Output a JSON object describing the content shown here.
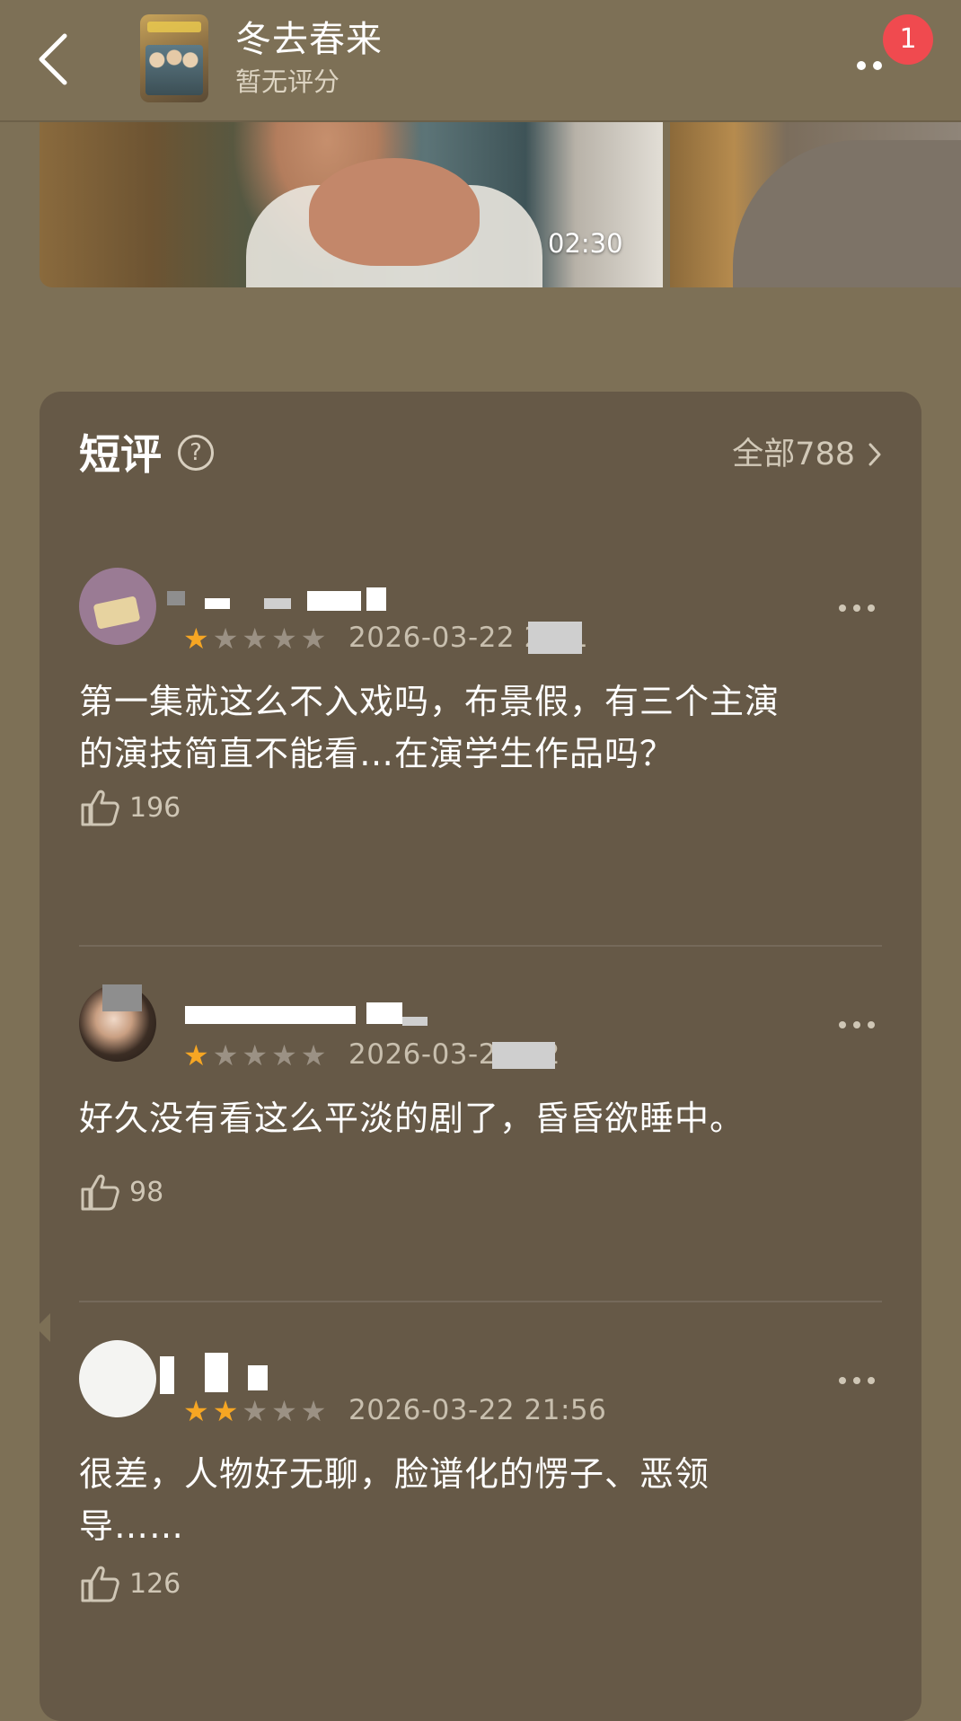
{
  "header": {
    "title": "冬去春来",
    "subtitle": "暂无评分",
    "notification_count": "1"
  },
  "media": {
    "duration": "02:30"
  },
  "reviews_section": {
    "title": "短评",
    "help_icon_text": "?",
    "all_label": "全部788",
    "items": [
      {
        "stars": 1,
        "date": "2026-03-22 20:1",
        "text_lines": [
          "第一集就这么不入戏吗，布景假，有三个主演",
          "的演技简直不能看…在演学生作品吗？"
        ],
        "likes": "196"
      },
      {
        "stars": 1,
        "date": "2026-03-22 22",
        "text_lines": [
          "好久没有看这么平淡的剧了，昏昏欲睡中。"
        ],
        "likes": "98"
      },
      {
        "stars": 2,
        "date": "2026-03-22 21:56",
        "text_lines": [
          "很差，人物好无聊，脸谱化的愣子、恶领",
          "导……"
        ],
        "likes": "126"
      }
    ]
  },
  "colors": {
    "background": "#7d7056",
    "card": "#665947",
    "star_on": "#f6a623",
    "badge": "#f04a4f"
  }
}
